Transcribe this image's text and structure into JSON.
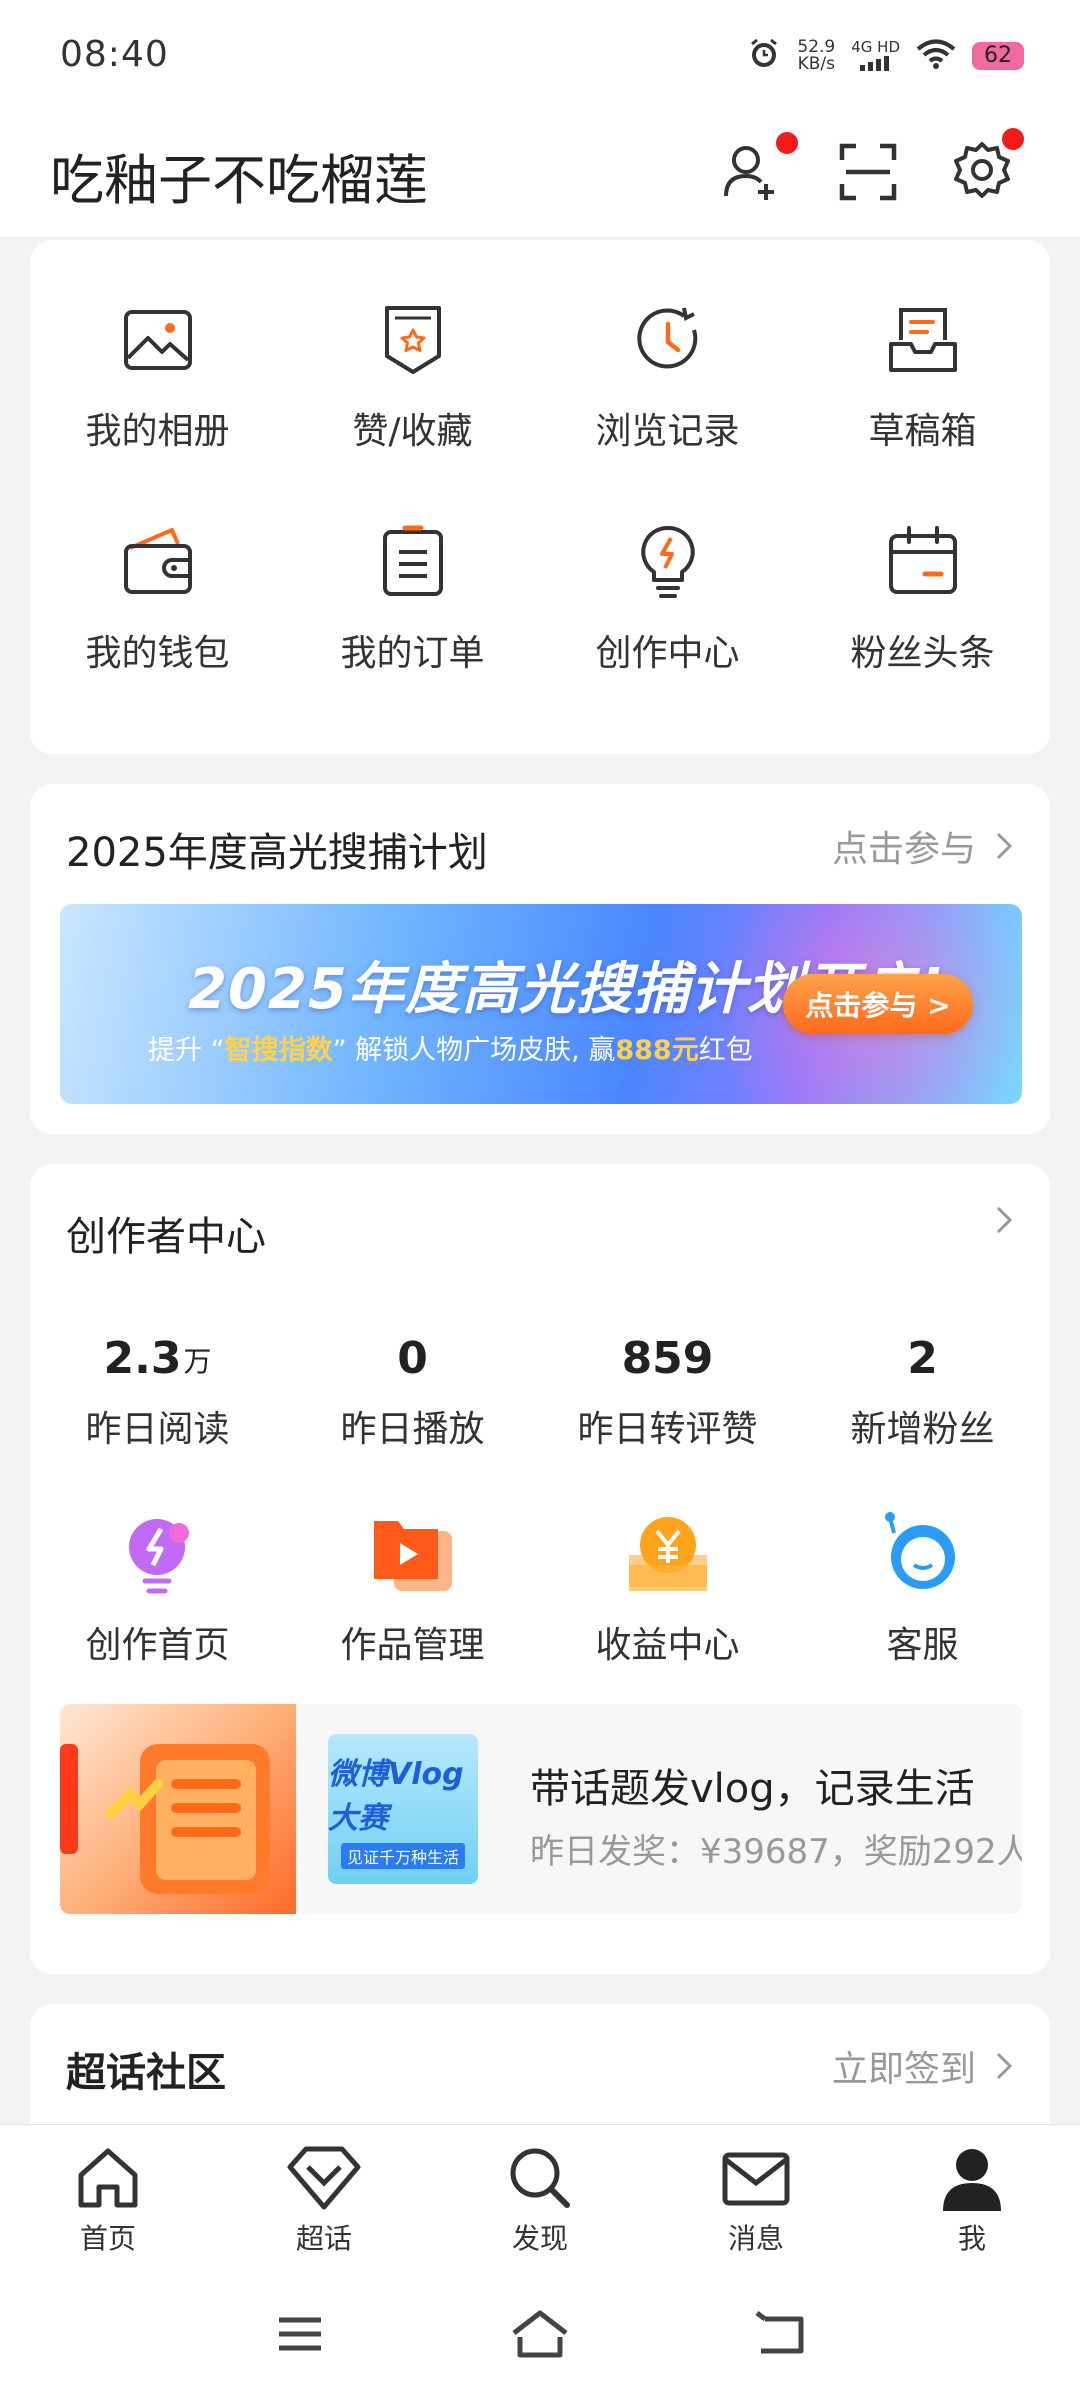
{
  "status_bar": {
    "time": "08:40",
    "speed_value": "52.9",
    "speed_unit": "KB/s",
    "network": "4G HD",
    "battery": "62"
  },
  "header": {
    "username": "吃釉子不吃榴莲"
  },
  "quick_grid": {
    "items": [
      {
        "label": "我的相册",
        "icon": "photo-album-icon"
      },
      {
        "label": "赞/收藏",
        "icon": "favorites-icon"
      },
      {
        "label": "浏览记录",
        "icon": "history-icon"
      },
      {
        "label": "草稿箱",
        "icon": "drafts-icon"
      },
      {
        "label": "我的钱包",
        "icon": "wallet-icon"
      },
      {
        "label": "我的订单",
        "icon": "orders-icon"
      },
      {
        "label": "创作中心",
        "icon": "creation-icon"
      },
      {
        "label": "粉丝头条",
        "icon": "fan-headline-icon"
      }
    ]
  },
  "campaign": {
    "title": "2025年度高光搜捕计划",
    "link": "点击参与",
    "banner_title": "2025年度高光搜捕计划开启!",
    "banner_sub_1": "提升 “",
    "banner_sub_hl": "智搜指数",
    "banner_sub_2": "” 解锁人物广场皮肤, 赢",
    "banner_sub_money": "888元",
    "banner_sub_3": "红包",
    "banner_button": "点击参与 >"
  },
  "creator": {
    "title": "创作者中心",
    "stats": [
      {
        "value": "2.3",
        "unit": "万",
        "label": "昨日阅读"
      },
      {
        "value": "0",
        "unit": "",
        "label": "昨日播放"
      },
      {
        "value": "859",
        "unit": "",
        "label": "昨日转评赞"
      },
      {
        "value": "2",
        "unit": "",
        "label": "新增粉丝"
      }
    ],
    "tools": [
      {
        "label": "创作首页",
        "icon": "creator-home-icon"
      },
      {
        "label": "作品管理",
        "icon": "works-manage-icon"
      },
      {
        "label": "收益中心",
        "icon": "income-icon"
      },
      {
        "label": "客服",
        "icon": "customer-service-icon"
      }
    ],
    "promo": {
      "thumb_title": "微博Vlog大赛",
      "thumb_tag": "见证千万种生活",
      "title": "带话题发vlog，记录生活",
      "subtitle": "昨日发奖：¥39687，奖励292人"
    }
  },
  "supertopic": {
    "title": "超话社区",
    "link": "立即签到"
  },
  "bottom_nav": [
    {
      "label": "首页",
      "icon": "home-icon"
    },
    {
      "label": "超话",
      "icon": "supertopic-icon"
    },
    {
      "label": "发现",
      "icon": "discover-icon"
    },
    {
      "label": "消息",
      "icon": "message-icon"
    },
    {
      "label": "我",
      "icon": "profile-icon"
    }
  ],
  "colors": {
    "accent": "#ff6a1a",
    "icon_dark": "#333333",
    "badge": "#f21a1a"
  }
}
